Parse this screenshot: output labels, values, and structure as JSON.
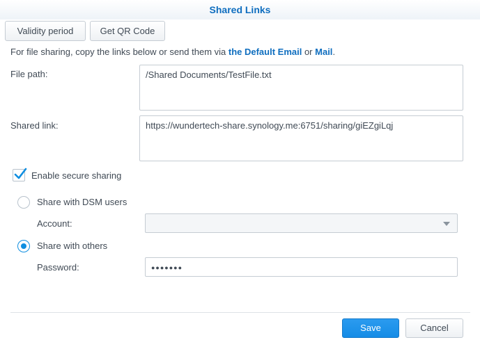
{
  "window": {
    "title": "Shared Links"
  },
  "toolbar": {
    "validity_label": "Validity period",
    "qr_label": "Get QR Code"
  },
  "description": {
    "prefix": "For file sharing, copy the links below or send them via ",
    "email_link": "the Default Email",
    "or": " or ",
    "mail_link": "Mail",
    "suffix": "."
  },
  "file_path": {
    "label": "File path:",
    "value": "/Shared Documents/TestFile.txt"
  },
  "shared_link": {
    "label": "Shared link:",
    "value": "https://wundertech-share.synology.me:6751/sharing/giEZgiLqj"
  },
  "secure_sharing": {
    "label": "Enable secure sharing",
    "checked": true
  },
  "dsm_users": {
    "label": "Share with DSM users",
    "selected": false
  },
  "account": {
    "label": "Account:",
    "value": ""
  },
  "others": {
    "label": "Share with others",
    "selected": true
  },
  "password": {
    "label": "Password:",
    "masked": "●●●●●●●"
  },
  "footer": {
    "save_label": "Save",
    "cancel_label": "Cancel"
  },
  "colors": {
    "accent": "#0f6ebf",
    "primary_button": "#158ce6",
    "radio_active": "#0f8ee0"
  }
}
